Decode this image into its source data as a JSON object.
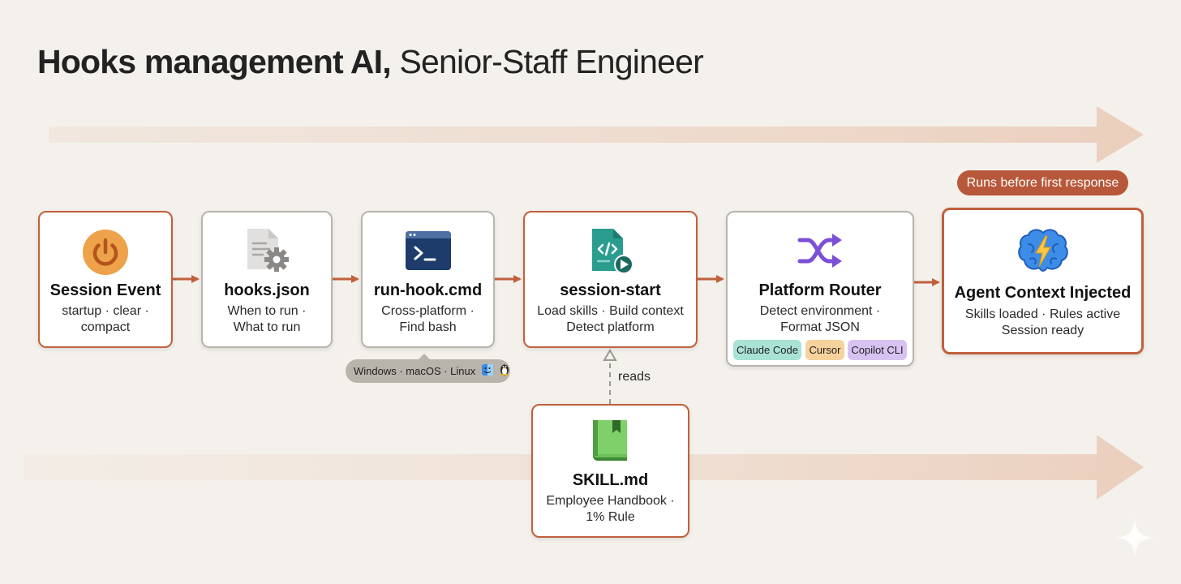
{
  "title": {
    "bold": "Hooks management AI,",
    "rest": "Senior-Staff  Engineer"
  },
  "nodes": {
    "session_event": {
      "title": "Session Event",
      "line1": "startup · clear ·",
      "line2": "compact",
      "icon": "power-icon"
    },
    "hooks_json": {
      "title": "hooks.json",
      "line1": "When to run ·",
      "line2": "What to run",
      "icon": "config-file-icon"
    },
    "run_hook": {
      "title": "run-hook.cmd",
      "line1": "Cross-platform ·",
      "line2": "Find bash",
      "icon": "terminal-icon"
    },
    "session_start": {
      "title": "session-start",
      "line1": "Load skills · Build context",
      "line2": "Detect platform",
      "icon": "script-file-icon"
    },
    "platform_router": {
      "title": "Platform Router",
      "line1": "Detect environment ·",
      "line2": "Format JSON",
      "icon": "shuffle-icon"
    },
    "agent_context": {
      "title": "Agent Context Injected",
      "line1": "Skills loaded · Rules active",
      "line2": "Session ready",
      "icon": "brain-icon"
    },
    "skill_md": {
      "title": "SKILL.md",
      "line1": "Employee Handbook ·",
      "line2": "1% Rule",
      "icon": "book-icon"
    }
  },
  "os_pill": {
    "text": "Windows · macOS · Linux"
  },
  "platform_chips": [
    {
      "label": "Claude Code",
      "color": "#a9e3d6"
    },
    {
      "label": "Cursor",
      "color": "#f6d29c"
    },
    {
      "label": "Copilot CLI",
      "color": "#d8c2f2"
    }
  ],
  "badge": {
    "text": "Runs before first response"
  },
  "reads_label": "reads",
  "colors": {
    "accent": "#c0603d",
    "neutral_border": "#bab5ad",
    "background": "#f4f1ec",
    "badge": "#b8583a"
  }
}
